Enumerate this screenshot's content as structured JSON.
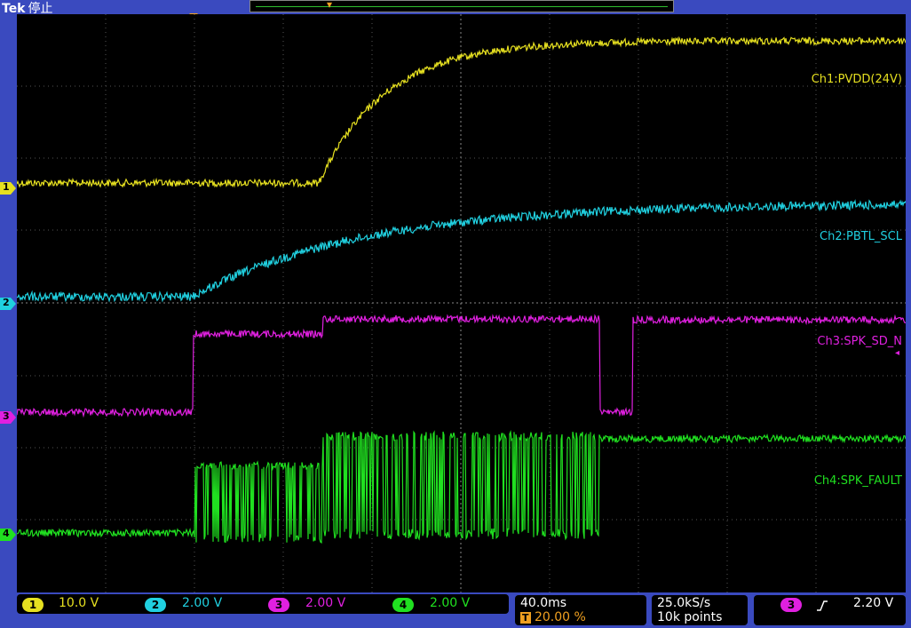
{
  "brand": {
    "logo": "Tek",
    "status": "停止"
  },
  "trigger_marker": "T",
  "channels": [
    {
      "num": "1",
      "label": "Ch1:PVDD(24V)",
      "scale": "10.0 V",
      "color": "#e6e020"
    },
    {
      "num": "2",
      "label": "Ch2:PBTL_SCL",
      "scale": "2.00 V",
      "color": "#20d0e0"
    },
    {
      "num": "3",
      "label": "Ch3:SPK_SD_N",
      "scale": "2.00 V",
      "color": "#e020e0"
    },
    {
      "num": "4",
      "label": "Ch4:SPK_FAULT",
      "scale": "2.00 V",
      "color": "#20e020"
    }
  ],
  "timebase": {
    "scale": "40.0ms",
    "trigger_position": "20.00 %"
  },
  "acquisition": {
    "sample_rate": "25.0kS/s",
    "record_length": "10k points"
  },
  "trigger": {
    "source": "3",
    "slope": "rising",
    "level": "2.20 V"
  }
}
